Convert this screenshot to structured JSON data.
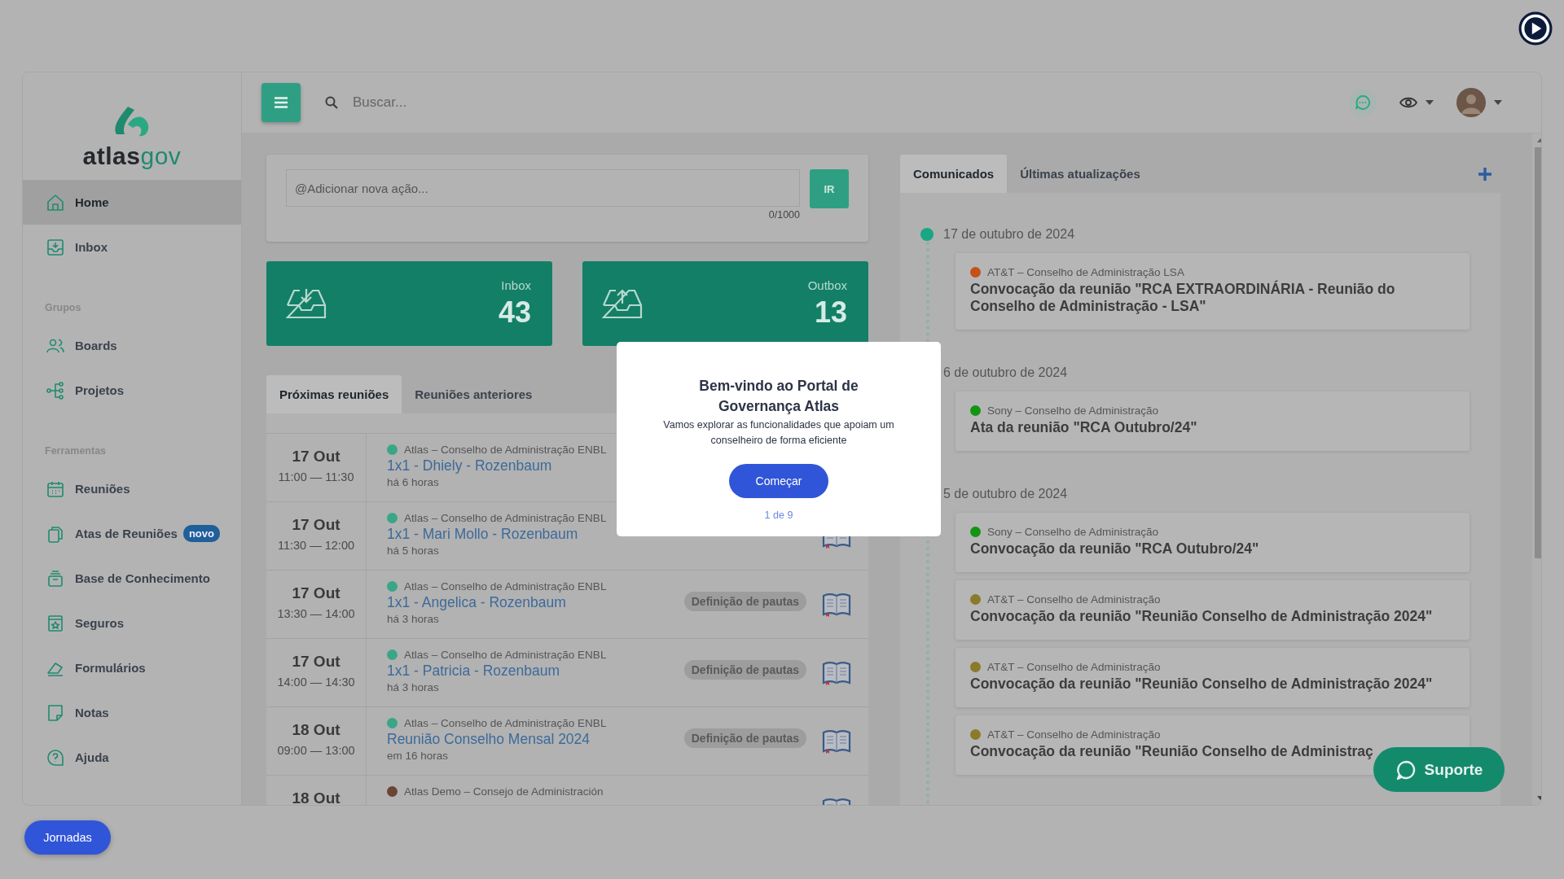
{
  "sidebar": {
    "logo": {
      "dark": "atlas",
      "light": "gov"
    },
    "groups": [
      {
        "items": [
          {
            "label": "Home",
            "selected": true
          },
          {
            "label": "Inbox",
            "selected": false
          }
        ]
      },
      {
        "heading": "Grupos",
        "items": [
          {
            "label": "Boards",
            "selected": false
          },
          {
            "label": "Projetos",
            "selected": false
          }
        ]
      },
      {
        "heading": "Ferramentas",
        "items": [
          {
            "label": "Reuniões",
            "selected": false
          },
          {
            "label": "Atas de Reuniões",
            "badge": "novo",
            "selected": false
          },
          {
            "label": "Base de Conhecimento",
            "selected": false
          },
          {
            "label": "Seguros",
            "selected": false
          },
          {
            "label": "Formulários",
            "selected": false
          },
          {
            "label": "Notas",
            "selected": false
          },
          {
            "label": "Ajuda",
            "selected": false
          }
        ]
      }
    ]
  },
  "topbar": {
    "search": {
      "placeholder": "Buscar..."
    }
  },
  "action": {
    "placeholder": "@Adicionar nova ação...",
    "counter": "0/1000",
    "button": "IR"
  },
  "stats": [
    {
      "kind": "in",
      "label": "Inbox",
      "value": "43"
    },
    {
      "kind": "out",
      "label": "Outbox",
      "value": "13"
    }
  ],
  "meetings": {
    "tabs": [
      {
        "label": "Próximas reuniões",
        "selected": true
      },
      {
        "label": "Reuniões anteriores",
        "selected": false
      }
    ],
    "rows": [
      {
        "day": "17 Out",
        "time": "11:00 — 11:30",
        "group": "Atlas – Conselho de Administração ENBL",
        "color": "#3aa687",
        "title": "1x1 - Dhiely - Rozenbaum",
        "ago": "há 6 horas"
      },
      {
        "day": "17 Out",
        "time": "11:30 — 12:00",
        "group": "Atlas – Conselho de Administração ENBL",
        "color": "#3aa687",
        "title": "1x1 - Mari Mollo - Rozenbaum",
        "ago": "há 5 horas"
      },
      {
        "day": "17 Out",
        "time": "13:30 — 14:00",
        "group": "Atlas – Conselho de Administração ENBL",
        "color": "#3aa687",
        "title": "1x1 - Angelica - Rozenbaum",
        "ago": "há 3 horas",
        "tag": "Definição de pautas"
      },
      {
        "day": "17 Out",
        "time": "14:00 — 14:30",
        "group": "Atlas – Conselho de Administração ENBL",
        "color": "#3aa687",
        "title": "1x1 - Patricia - Rozenbaum",
        "ago": "há 3 horas",
        "tag": "Definição de pautas"
      },
      {
        "day": "18 Out",
        "time": "09:00 — 13:00",
        "group": "Atlas – Conselho de Administração ENBL",
        "color": "#3aa687",
        "title": "Reunião Conselho Mensal 2024",
        "ago": "em 16 horas",
        "tag": "Definição de pautas"
      },
      {
        "day": "18 Out",
        "group": "Atlas Demo – Consejo de Administración",
        "color": "#6b4438"
      }
    ]
  },
  "news": {
    "tabs": [
      {
        "label": "Comunicados",
        "selected": true
      },
      {
        "label": "Últimas atualizações",
        "selected": false
      }
    ],
    "groups": [
      {
        "date": "17 de outubro de 2024",
        "items": [
          {
            "group": "AT&T – Conselho de Administração LSA",
            "color": "#c4501a",
            "title": "Convocação da reunião \"RCA EXTRAORDINÁRIA - Reunião do Conselho de Administração - LSA\""
          }
        ]
      },
      {
        "date": "6 de outubro de 2024",
        "items": [
          {
            "group": "Sony – Conselho de Administração",
            "color": "#139413",
            "title": "Ata da reunião \"RCA Outubro/24\""
          }
        ]
      },
      {
        "date": "5 de outubro de 2024",
        "items": [
          {
            "group": "Sony – Conselho de Administração",
            "color": "#139413",
            "title": "Convocação da reunião \"RCA Outubro/24\""
          },
          {
            "group": "AT&T – Conselho de Administração",
            "color": "#8a7a2a",
            "title": "Convocação da reunião \"Reunião Conselho de Administração 2024\""
          },
          {
            "group": "AT&T – Conselho de Administração",
            "color": "#8a7a2a",
            "title": "Convocação da reunião \"Reunião Conselho de Administração 2024\""
          },
          {
            "group": "AT&T – Conselho de Administração",
            "color": "#8a7a2a",
            "title": "Convocação da reunião \"Reunião Conselho de Administraç"
          }
        ]
      }
    ]
  },
  "modal": {
    "title": "Bem-vindo ao Portal de Governança Atlas",
    "text": "Vamos explorar as funcionalidades que apoiam um conselheiro de forma eficiente",
    "button": "Começar",
    "step": "1 de 9"
  },
  "journeys": {
    "label": "Jornadas"
  },
  "support": {
    "label": "Suporte"
  }
}
